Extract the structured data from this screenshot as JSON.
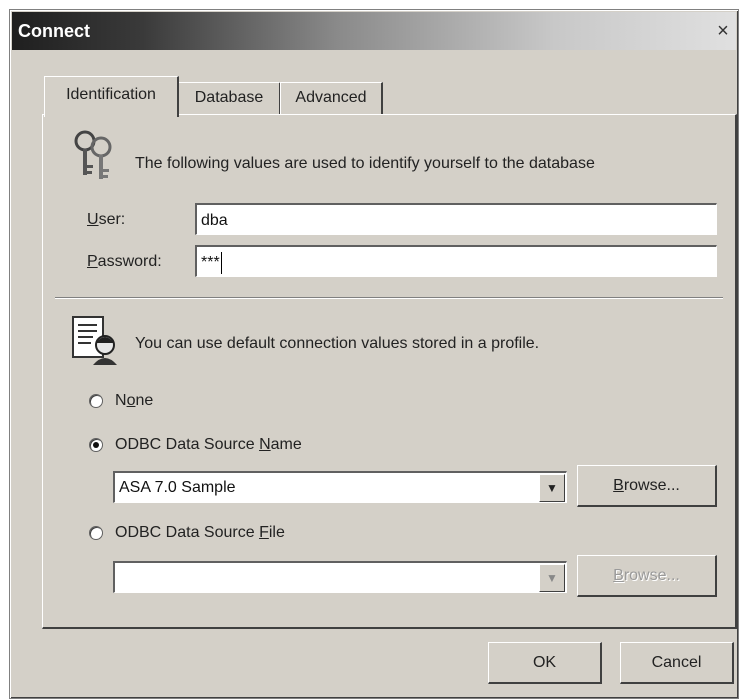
{
  "window": {
    "title": "Connect",
    "close_glyph": "×"
  },
  "tabs": [
    {
      "label": "Identification",
      "active": true
    },
    {
      "label": "Database",
      "active": false
    },
    {
      "label": "Advanced",
      "active": false
    }
  ],
  "identification": {
    "icon": "keys-icon",
    "intro": "The following values are used to identify yourself to the database",
    "user_label": "User:",
    "user_value": "dba",
    "password_label": "Password:",
    "password_value": "***"
  },
  "profile": {
    "icon": "profile-document-icon",
    "intro": "You can use default connection values stored in a profile.",
    "options": [
      {
        "label": "None",
        "checked": false
      },
      {
        "label": "ODBC Data Source Name",
        "checked": true
      },
      {
        "label": "ODBC Data Source File",
        "checked": false
      }
    ],
    "dsn_value": "ASA 7.0 Sample",
    "dsn_browse_label": "Browse...",
    "file_value": "",
    "file_browse_label": "Browse..."
  },
  "footer": {
    "ok_label": "OK",
    "cancel_label": "Cancel"
  }
}
